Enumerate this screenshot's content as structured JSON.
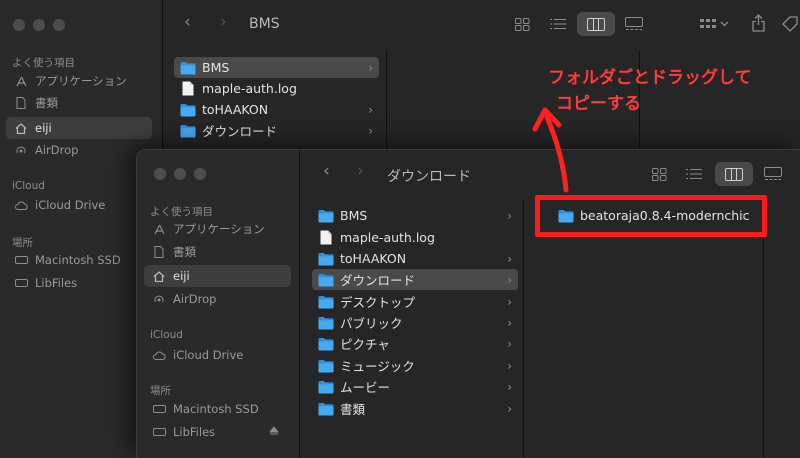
{
  "back_window": {
    "title": "BMS",
    "sidebar": {
      "favorites_header": "よく使う項目",
      "items": [
        "アプリケーション",
        "書類",
        "eiji",
        "AirDrop"
      ],
      "icloud_header": "iCloud",
      "icloud_items": [
        "iCloud Drive"
      ],
      "locations_header": "場所",
      "location_items": [
        "Macintosh SSD",
        "LibFiles"
      ]
    },
    "files": [
      "BMS",
      "maple-auth.log",
      "toHAAKON",
      "ダウンロード"
    ]
  },
  "front_window": {
    "title": "ダウンロード",
    "sidebar": {
      "favorites_header": "よく使う項目",
      "items": [
        "アプリケーション",
        "書類",
        "eiji",
        "AirDrop"
      ],
      "icloud_header": "iCloud",
      "icloud_items": [
        "iCloud Drive"
      ],
      "locations_header": "場所",
      "location_items": [
        "Macintosh SSD",
        "LibFiles"
      ]
    },
    "column1": [
      "BMS",
      "maple-auth.log",
      "toHAAKON",
      "ダウンロード",
      "デスクトップ",
      "パブリック",
      "ピクチャ",
      "ミュージック",
      "ムービー",
      "書類"
    ],
    "column2": [
      "beatoraja0.8.4-modernchic"
    ]
  },
  "annotation": {
    "line1": "フォルダごとドラッグして",
    "line2": "コピーする",
    "color": "#ff2a2a"
  },
  "colors": {
    "folder": "#3aa0e8",
    "highlight_box": "#ff1a1a"
  }
}
